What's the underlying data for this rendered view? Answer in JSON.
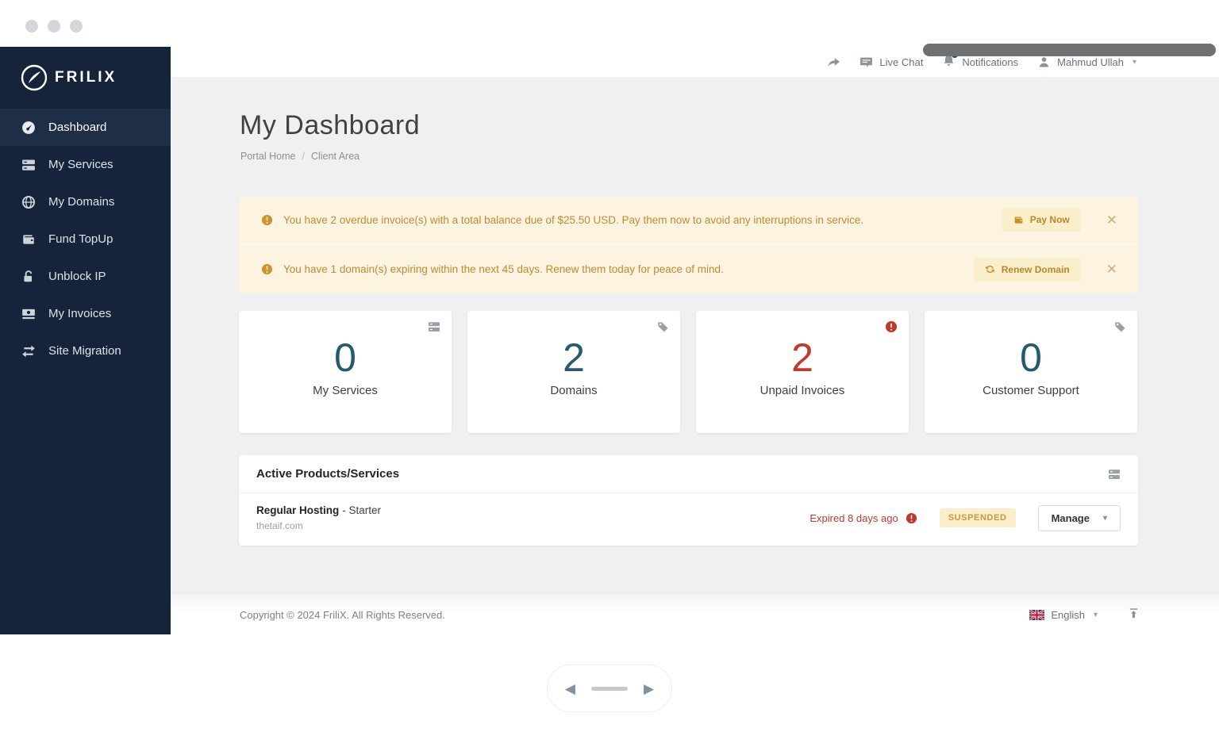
{
  "colors": {
    "sidebar_bg": "#16243b",
    "stat_default": "#265a70",
    "stat_alert": "#c0392b",
    "warning_text": "#bf8b2e",
    "badge_bg": "#fbeecb",
    "badge_text": "#c49a3c"
  },
  "icons": {
    "close": "✕",
    "caret_down": "▾",
    "prev": "◀",
    "next": "▶"
  },
  "sidebar": {
    "logo_text": "FRILIX",
    "items": [
      {
        "label": "Dashboard",
        "icon": "dashboard-gauge",
        "active": true
      },
      {
        "label": "My Services",
        "icon": "server"
      },
      {
        "label": "My Domains",
        "icon": "globe"
      },
      {
        "label": "Fund TopUp",
        "icon": "wallet"
      },
      {
        "label": "Unblock IP",
        "icon": "unlock"
      },
      {
        "label": "My Invoices",
        "icon": "money"
      },
      {
        "label": "Site Migration",
        "icon": "exchange-arrows"
      }
    ]
  },
  "topbar": {
    "live_chat_label": "Live Chat",
    "notifications_label": "Notifications",
    "user_name": "Mahmud Ullah"
  },
  "page": {
    "title": "My Dashboard",
    "breadcrumb_home": "Portal Home",
    "breadcrumb_sep": "/",
    "breadcrumb_current": "Client Area"
  },
  "alerts": [
    {
      "text": "You have 2 overdue invoice(s) with a total balance due of $25.50 USD. Pay them now to avoid any interruptions in service.",
      "button_label": "Pay Now"
    },
    {
      "text": "You have 1 domain(s) expiring within the next 45 days. Renew them today for peace of mind.",
      "button_label": "Renew Domain"
    }
  ],
  "stats": [
    {
      "value": "0",
      "label": "My Services",
      "color": "#265a70",
      "icon": "server"
    },
    {
      "value": "2",
      "label": "Domains",
      "color": "#265a70",
      "icon": "tag"
    },
    {
      "value": "2",
      "label": "Unpaid Invoices",
      "color": "#c0392b",
      "icon": "alert-circle"
    },
    {
      "value": "0",
      "label": "Customer Support",
      "color": "#265a70",
      "icon": "tag"
    }
  ],
  "products": {
    "title": "Active Products/Services",
    "rows": [
      {
        "name": "Regular Hosting",
        "plan": "- Starter",
        "domain": "thetaif.com",
        "expired": "Expired 8 days ago",
        "status": "SUSPENDED",
        "action": "Manage"
      }
    ]
  },
  "footer": {
    "copyright": "Copyright © 2024 FriliX. All Rights Reserved.",
    "language": "English"
  }
}
